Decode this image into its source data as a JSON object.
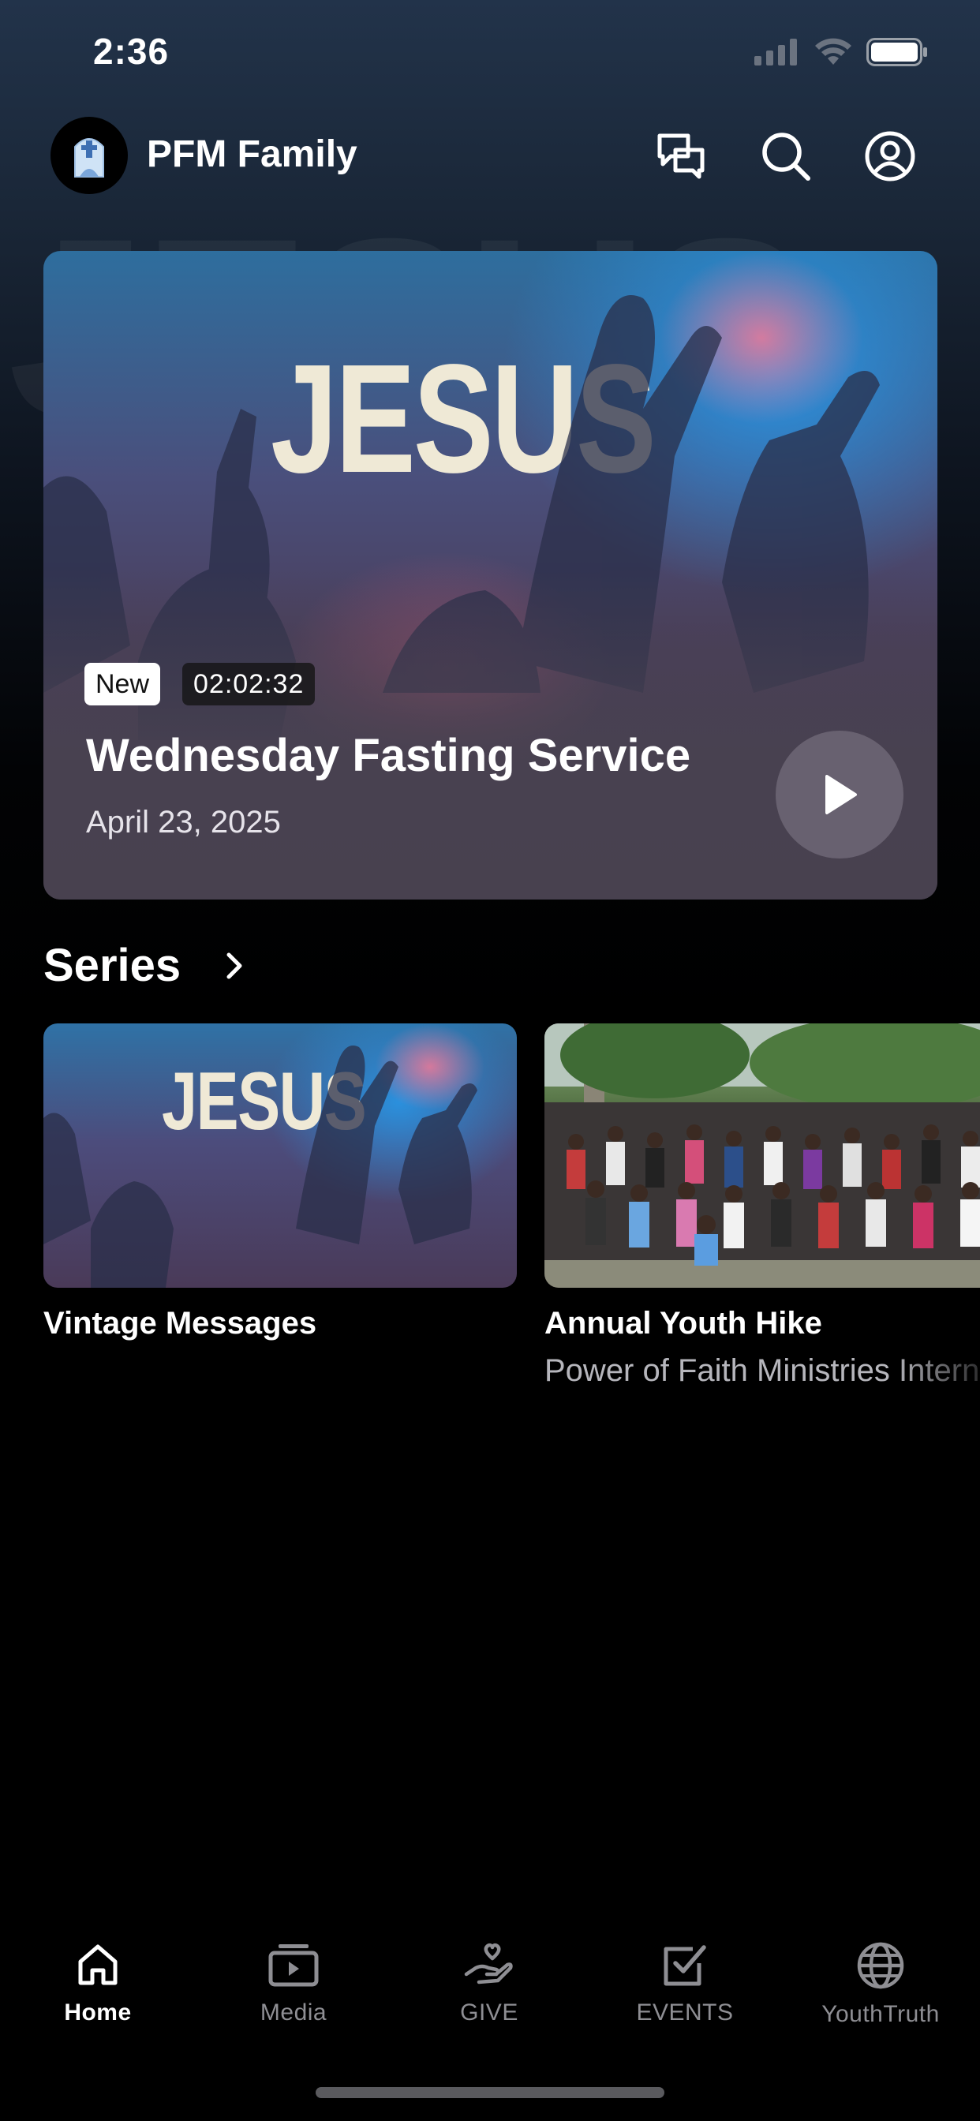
{
  "status_bar": {
    "time": "2:36"
  },
  "header": {
    "title": "PFM Family"
  },
  "hero": {
    "artwork_text": "JESUS",
    "badge_new": "New",
    "duration": "02:02:32",
    "title": "Wednesday Fasting Service",
    "date": "April 23, 2025"
  },
  "series": {
    "heading": "Series",
    "items": [
      {
        "artwork_text": "JESUS",
        "title": "Vintage Messages",
        "subtitle": ""
      },
      {
        "title": "Annual Youth Hike",
        "subtitle": "Power of Faith Ministries International"
      }
    ]
  },
  "tabbar": {
    "items": [
      {
        "label": "Home",
        "icon": "home-icon",
        "active": true
      },
      {
        "label": "Media",
        "icon": "media-icon",
        "active": false
      },
      {
        "label": "GIVE",
        "icon": "give-icon",
        "active": false
      },
      {
        "label": "EVENTS",
        "icon": "events-icon",
        "active": false
      },
      {
        "label": "YouthTruth",
        "icon": "globe-icon",
        "active": false
      }
    ]
  },
  "colors": {
    "background": "#000000",
    "hero_overlay": "#48414f",
    "inactive_tab": "#8e8e93"
  }
}
